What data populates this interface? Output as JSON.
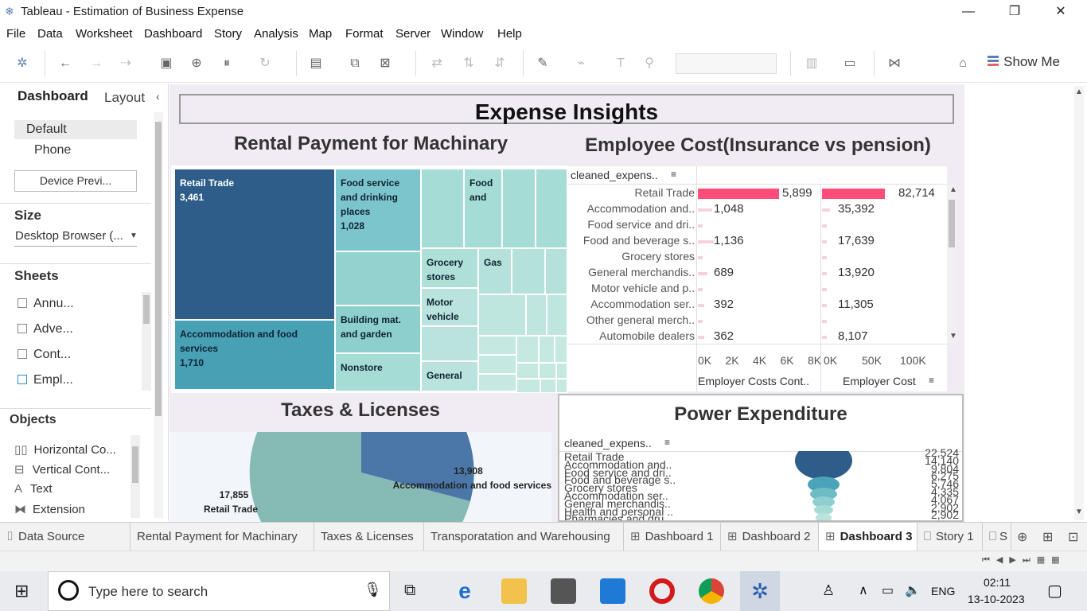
{
  "window": {
    "title": "Tableau - Estimation of Business Expense"
  },
  "menu": [
    "File",
    "Data",
    "Worksheet",
    "Dashboard",
    "Story",
    "Analysis",
    "Map",
    "Format",
    "Server",
    "Window",
    "Help"
  ],
  "toolbar": {
    "show_me": "Show Me"
  },
  "left_pane": {
    "tabs": [
      "Dashboard",
      "Layout"
    ],
    "devices": [
      "Default",
      "Phone"
    ],
    "device_preview": "Device Previ...",
    "size_heading": "Size",
    "size_value": "Desktop Browser (...",
    "sheets_heading": "Sheets",
    "sheets": [
      "Annu...",
      "Adve...",
      "Cont...",
      "Empl..."
    ],
    "objects_heading": "Objects",
    "objects": [
      "Horizontal Co...",
      "Vertical Cont...",
      "Text",
      "Extension"
    ]
  },
  "dashboard": {
    "title": "Expense Insights",
    "treemap": {
      "title": "Rental Payment for Machinary",
      "cells": [
        {
          "label": "Retail Trade",
          "value": "3,461"
        },
        {
          "label": "Accommodation and food services",
          "value": "1,710"
        },
        {
          "label": "Food service and drinking places",
          "value": "1,028"
        },
        {
          "label": "Food and",
          "value": ""
        },
        {
          "label": "Grocery stores",
          "value": ""
        },
        {
          "label": "Gas",
          "value": ""
        },
        {
          "label": "Building mat. and garden",
          "value": ""
        },
        {
          "label": "Motor vehicle",
          "value": ""
        },
        {
          "label": "Nonstore",
          "value": ""
        },
        {
          "label": "General",
          "value": ""
        }
      ]
    },
    "employee": {
      "title": "Employee Cost(Insurance vs pension)",
      "dim_header": "cleaned_expens..",
      "rows": [
        "Retail Trade",
        "Accommodation and..",
        "Food service and dri..",
        "Food and beverage s..",
        "Grocery stores",
        "General merchandis..",
        "Motor vehicle and p..",
        "Accommodation ser..",
        "Other general merch..",
        "Automobile dealers"
      ],
      "col1_values": [
        "5,899",
        "1,048",
        "",
        "1,136",
        "",
        "689",
        "",
        "392",
        "",
        "362"
      ],
      "col2_values": [
        "82,714",
        "35,392",
        "",
        "17,639",
        "",
        "13,920",
        "",
        "11,305",
        "",
        "8,107"
      ],
      "axis1_ticks": [
        "0K",
        "2K",
        "4K",
        "6K",
        "8K"
      ],
      "axis2_ticks": [
        "0K",
        "50K",
        "100K"
      ],
      "axis1_label": "Employer Costs Cont..",
      "axis2_label": "Employer Cost"
    },
    "taxes": {
      "title": "Taxes & Licenses",
      "labels": [
        {
          "value": "17,855",
          "name": "Retail Trade"
        },
        {
          "value": "13,908",
          "name": "Accommodation and food services"
        }
      ]
    },
    "power": {
      "title": "Power Expenditure",
      "dim_header": "cleaned_expens..",
      "rows": [
        "Retail Trade",
        "Accommodation and..",
        "Food service and dri..",
        "Food and beverage s..",
        "Grocery stores",
        "Accommodation ser..",
        "General merchandis..",
        "Health and personal ..",
        "Pharmacies and dru.."
      ],
      "values": [
        "22,524",
        "14,140",
        "9,804",
        "6,275",
        "5,746",
        "4,335",
        "4,067",
        "2,902",
        "2,902"
      ]
    }
  },
  "sheet_tabs": [
    "Data Source",
    "Rental Payment for Machinary",
    "Taxes & Licenses",
    "Transporatation and Warehousing",
    "Dashboard 1",
    "Dashboard 2",
    "Dashboard 3",
    "Story 1",
    "S"
  ],
  "taskbar": {
    "search_placeholder": "Type here to search",
    "lang": "ENG",
    "time": "02:11",
    "date": "13-10-2023"
  },
  "colors": {
    "bar_pink": "#ff4d7a",
    "treemap_dark": "#2e5d8a",
    "treemap_mid": "#4aa3b8",
    "treemap_light": "#b9e3dc"
  }
}
